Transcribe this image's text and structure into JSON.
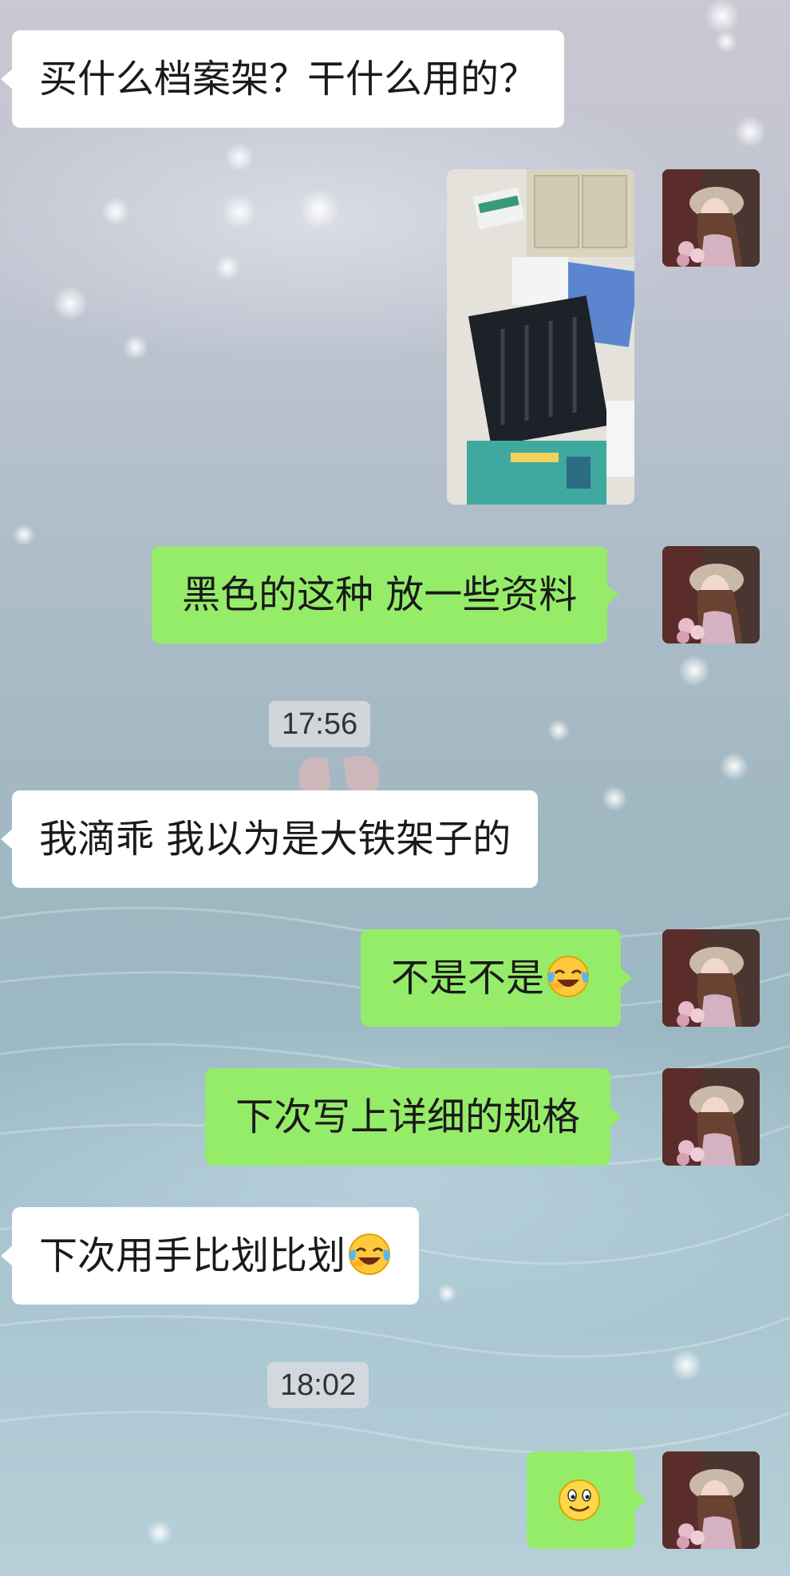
{
  "messages": [
    {
      "side": "left",
      "text": "买什么档案架？干什么用的？"
    },
    {
      "side": "right",
      "type": "image",
      "icon": "office-photo-file-rack"
    },
    {
      "side": "right",
      "text": "黑色的这种 放一些资料"
    },
    {
      "side": "time",
      "text": "17:56"
    },
    {
      "side": "left",
      "text": "我滴乖 我以为是大铁架子的"
    },
    {
      "side": "right",
      "text": "不是不是",
      "emoji": "laugh-cry-emoji"
    },
    {
      "side": "right",
      "text": "下次写上详细的规格"
    },
    {
      "side": "left",
      "text": "下次用手比划比划",
      "emoji": "laugh-cry-emoji"
    },
    {
      "side": "time",
      "text": "18:02"
    },
    {
      "side": "right",
      "type": "emoji",
      "emoji": "smile-emoji"
    }
  ],
  "colors": {
    "outgoing_bubble": "#95ec69",
    "incoming_bubble": "#ffffff",
    "timestamp_bg": "#d7dade"
  },
  "avatar": {
    "icon": "user-avatar-girl-with-hat-and-flowers"
  }
}
